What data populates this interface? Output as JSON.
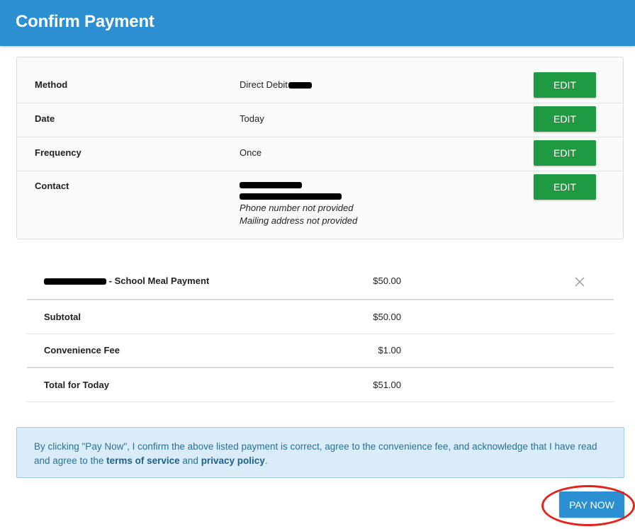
{
  "header": {
    "title": "Confirm Payment"
  },
  "details": {
    "edit_label": "EDIT",
    "rows": [
      {
        "label": "Method",
        "value": "Direct Debit"
      },
      {
        "label": "Date",
        "value": "Today"
      },
      {
        "label": "Frequency",
        "value": "Once"
      },
      {
        "label": "Contact",
        "line3": "Phone number not provided",
        "line4": "Mailing address not provided"
      }
    ]
  },
  "summary": {
    "item": {
      "label": "- School Meal Payment",
      "amount": "$50.00"
    },
    "subtotal": {
      "label": "Subtotal",
      "amount": "$50.00"
    },
    "fee": {
      "label": "Convenience Fee",
      "amount": "$1.00"
    },
    "total": {
      "label": "Total for Today",
      "amount": "$51.00"
    }
  },
  "notice": {
    "text_before": "By clicking \"Pay Now\", I confirm the above listed payment is correct, agree to the convenience fee, and acknowledge that I have read and agree to the ",
    "terms_link": "terms of service",
    "and_text": " and ",
    "privacy_link": "privacy policy",
    "text_after": "."
  },
  "actions": {
    "pay_now_label": "PAY NOW"
  },
  "colors": {
    "header": "#2b8fd1",
    "edit_button": "#1f9a42",
    "pay_button": "#2b8fd1",
    "notice_bg": "#d9ecf8",
    "annotation_circle": "#e3221b"
  }
}
